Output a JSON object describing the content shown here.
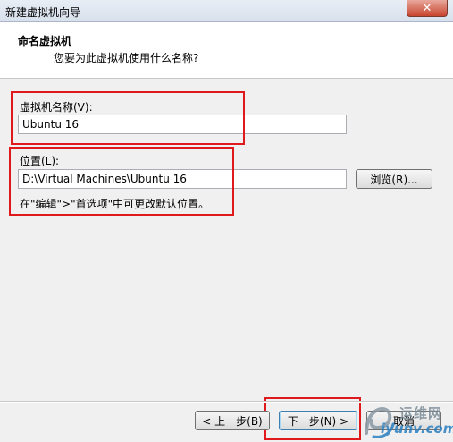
{
  "window": {
    "title": "新建虚拟机向导",
    "close_glyph": "✕"
  },
  "header": {
    "title": "命名虚拟机",
    "subtitle": "您要为此虚拟机使用什么名称?"
  },
  "vm_name": {
    "label": "虚拟机名称(V):",
    "value": "Ubuntu 16"
  },
  "location": {
    "label": "位置(L):",
    "value": "D:\\Virtual Machines\\Ubuntu 16",
    "browse_label": "浏览(R)...",
    "hint": "在\"编辑\">\"首选项\"中可更改默认位置。"
  },
  "footer": {
    "back_label": "< 上一步(B)",
    "next_label": "下一步(N) >",
    "cancel_label": "取消"
  },
  "watermark": {
    "top_text": "运维网",
    "bottom_text": "iyunv.com"
  },
  "colors": {
    "highlight": "#e0191d",
    "header_bg": "#ffffff",
    "dialog_bg": "#f0f0f0"
  }
}
